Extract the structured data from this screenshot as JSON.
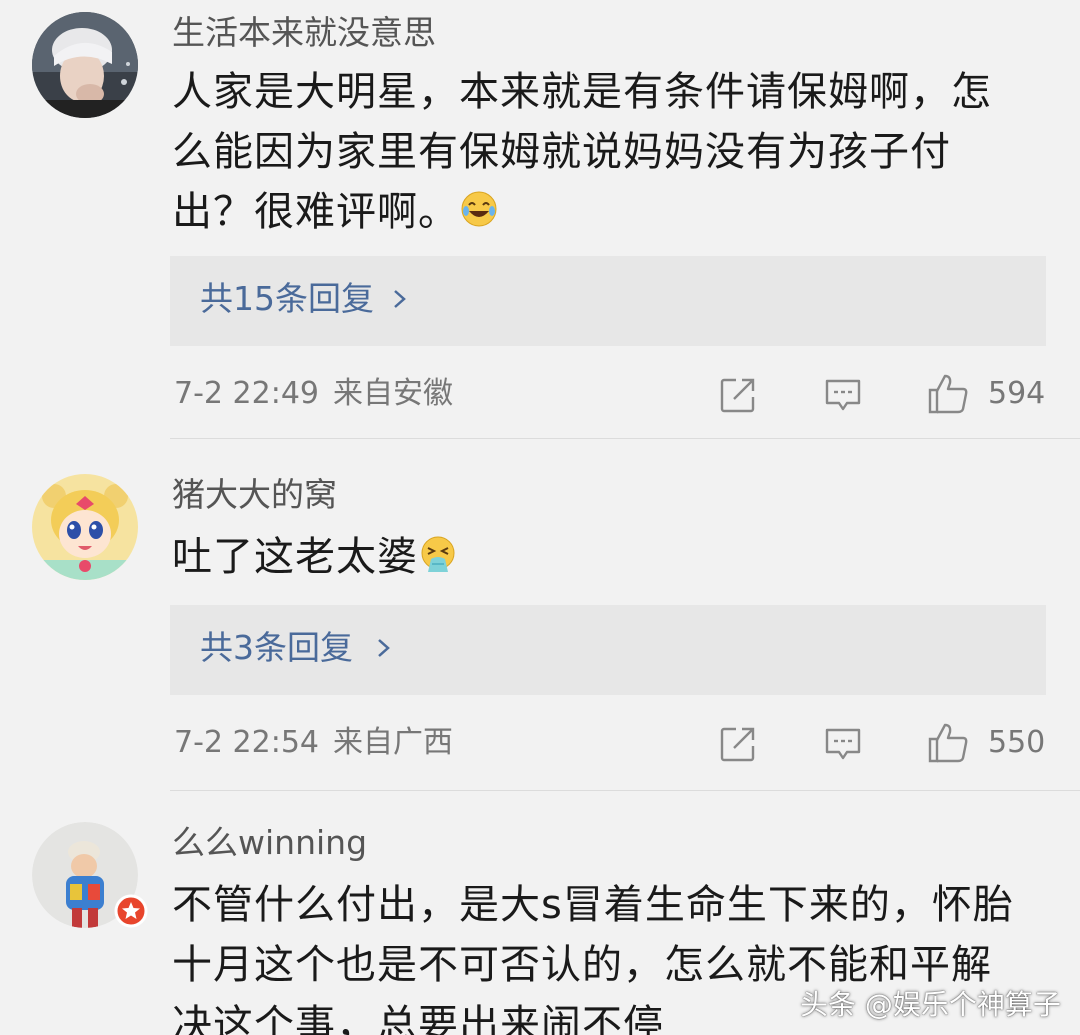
{
  "comments": [
    {
      "username": "生活本来就没意思",
      "text": "人家是大明星，本来就是有条件请保姆啊，怎么能因为家里有保姆就说妈妈没有为孩子付出？很难评啊。",
      "emoji": "laughing-tears-emoji",
      "replies_label": "共15条回复",
      "date": "7-2 22:49",
      "location": "来自安徽",
      "likes": "594"
    },
    {
      "username": "猪大大的窝",
      "text": "吐了这老太婆",
      "emoji": "vomiting-face-emoji",
      "replies_label": "共3条回复",
      "date": "7-2 22:54",
      "location": "来自广西",
      "likes": "550"
    },
    {
      "username": "么么winning",
      "text": "不管什么付出，是大s冒着生命生下来的，怀胎十月这个也是不可否认的，怎么就不能和平解决这个事，总要出来闹不停",
      "badge": "verified-badge"
    }
  ],
  "icons": {
    "share": "share-icon",
    "comment": "comment-icon",
    "like": "thumbs-up-icon",
    "chevron": "chevron-right-icon"
  },
  "colors": {
    "background": "#f2f2f2",
    "reply_box": "#e7e7e7",
    "reply_link": "#4a6a9a",
    "badge": "#e8452c"
  },
  "watermark": "头条 @娱乐个神算子"
}
